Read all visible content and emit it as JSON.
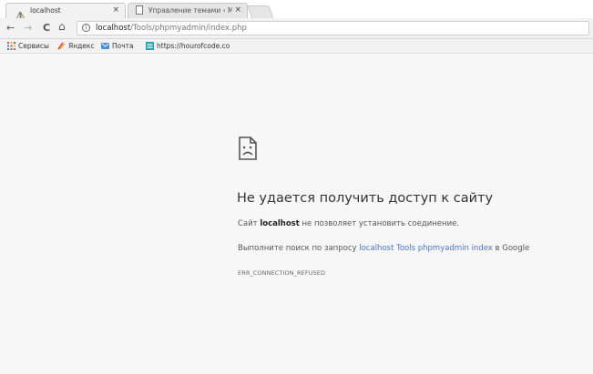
{
  "tabs": [
    {
      "title": "localhost",
      "close": "×",
      "favicon": "phpmyadmin-sailboat-icon"
    },
    {
      "title": "Управление темами ‹ M",
      "close": "×",
      "favicon": "page-icon"
    }
  ],
  "toolbar": {
    "back": "←",
    "forward": "→",
    "reload": "C",
    "home": "⌂",
    "info": "i",
    "url_host": "localhost",
    "url_path": "/Tools/phpmyadmin/index.php"
  },
  "bookmarks": [
    {
      "label": "Сервисы",
      "icon": "apps-grid-icon"
    },
    {
      "label": "Яндекс",
      "icon": "yandex-icon"
    },
    {
      "label": "Почта",
      "icon": "mail-icon"
    },
    {
      "label": "https://hourofcode.co",
      "icon": "hourofcode-icon"
    }
  ],
  "error": {
    "title": "Не удается получить доступ к сайту",
    "site_prefix": "Сайт ",
    "site_host": "localhost",
    "site_suffix": " не позволяет установить соединение.",
    "search_prefix": "Выполните поиск по запросу ",
    "search_link": "localhost Tools phpmyadmin index",
    "search_suffix": " в Google",
    "code": "ERR_CONNECTION_REFUSED"
  },
  "colors": {
    "link": "#4a73c4",
    "background": "#f7f7f7"
  }
}
